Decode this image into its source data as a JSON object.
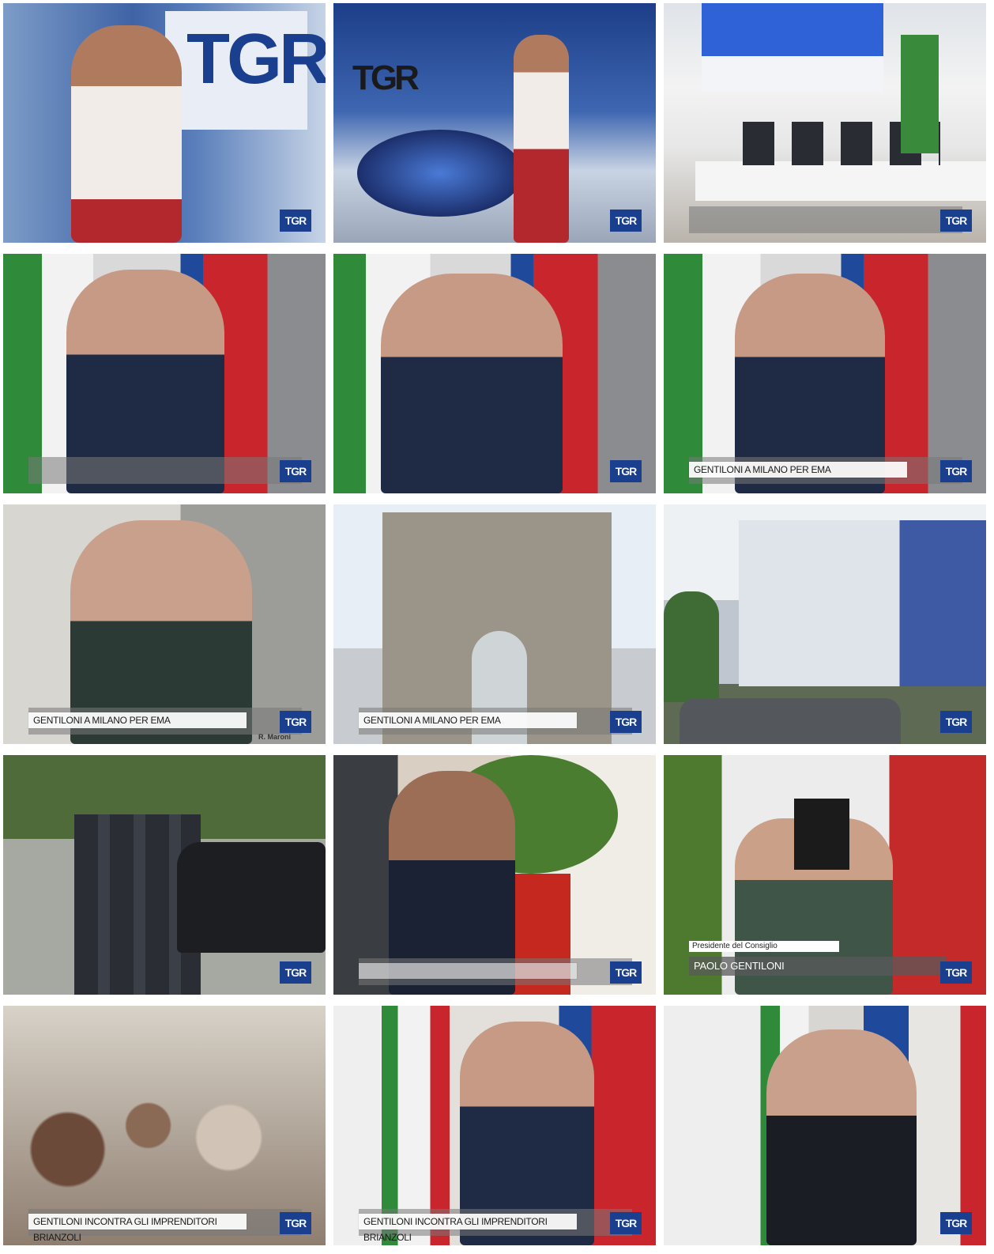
{
  "logo_text": "TGR",
  "frames": [
    {
      "id": "f1",
      "caption": "",
      "studio_logo": "TGR"
    },
    {
      "id": "f2",
      "caption": "",
      "studio_logo": "TGR"
    },
    {
      "id": "f3",
      "caption": ""
    },
    {
      "id": "f4",
      "caption": ""
    },
    {
      "id": "f5",
      "caption": ""
    },
    {
      "id": "f6",
      "caption": "GENTILONI A MILANO PER EMA"
    },
    {
      "id": "f7",
      "caption": "GENTILONI A MILANO PER EMA",
      "corner_label": "R. Maroni"
    },
    {
      "id": "f8",
      "caption": "GENTILONI A MILANO PER EMA"
    },
    {
      "id": "f9",
      "caption": ""
    },
    {
      "id": "f10",
      "caption": ""
    },
    {
      "id": "f11",
      "caption": ""
    },
    {
      "id": "f12",
      "caption": "",
      "name_title": "Presidente del Consiglio",
      "name": "PAOLO GENTILONI"
    },
    {
      "id": "f13",
      "caption": "GENTILONI INCONTRA GLI IMPRENDITORI BRIANZOLI"
    },
    {
      "id": "f14",
      "caption": "GENTILONI INCONTRA GLI IMPRENDITORI BRIANZOLI"
    },
    {
      "id": "f15",
      "caption": ""
    }
  ]
}
